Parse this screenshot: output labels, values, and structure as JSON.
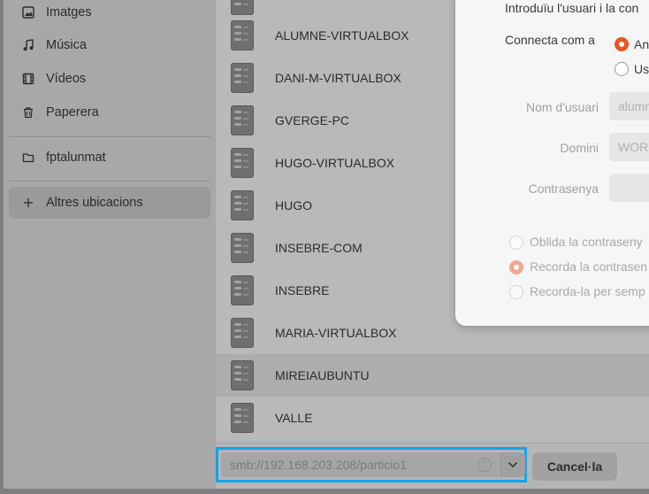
{
  "sidebar": {
    "items": [
      {
        "label": "Imatges",
        "icon": "image-icon"
      },
      {
        "label": "Música",
        "icon": "music-note-icon"
      },
      {
        "label": "Vídeos",
        "icon": "film-icon"
      },
      {
        "label": "Paperera",
        "icon": "trash-icon"
      }
    ],
    "bookmark": {
      "label": "fptalunmat",
      "icon": "folder-icon"
    },
    "other_locations": {
      "label": "Altres ubicacions",
      "icon": "plus-icon"
    }
  },
  "network_list": [
    "ALUMNE-VIRTUALBOX",
    "DANI-M-VIRTUALBOX",
    "GVERGE-PC",
    "HUGO-VIRTUALBOX",
    "HUGO",
    "INSEBRE-COM",
    "INSEBRE",
    "MARIA-VIRTUALBOX",
    "MIREIAUBUNTU",
    "VALLE"
  ],
  "footer": {
    "address_value": "smb://192.168.203.208/particio1",
    "cancel_label": "Cancel·la"
  },
  "dialog": {
    "intro_text": "Introduïu l'usuari i la con",
    "connect_as_label": "Connecta com a",
    "connect_options": [
      "An",
      "Us"
    ],
    "username_label": "Nom d'usuari",
    "username_value": "alumn",
    "domain_label": "Domini",
    "domain_value": "WOR",
    "password_label": "Contrasenya",
    "password_value": "",
    "remember_options": [
      "Oblida la contraseny",
      "Recorda la contrasen",
      "Recorda-la per semp"
    ]
  },
  "colors": {
    "accent": "#e95420",
    "highlight_border": "#17a2e8"
  }
}
